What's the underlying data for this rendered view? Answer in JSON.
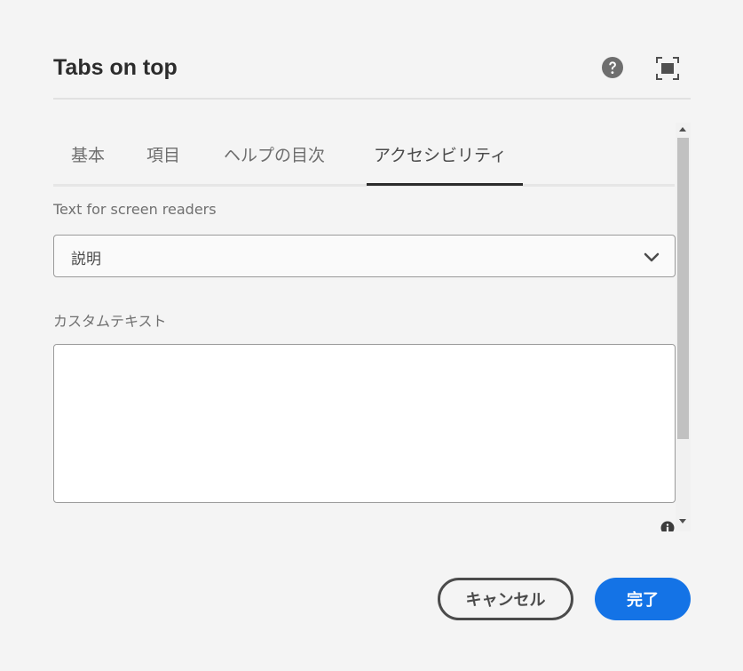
{
  "dialog": {
    "title": "Tabs on top",
    "help_icon": "help-circle-icon",
    "fullscreen_icon": "fullscreen-icon"
  },
  "tabs": [
    {
      "label": "基本",
      "active": false
    },
    {
      "label": "項目",
      "active": false
    },
    {
      "label": "ヘルプの目次",
      "active": false
    },
    {
      "label": "アクセシビリティ",
      "active": true
    }
  ],
  "screen_reader": {
    "label": "Text for screen readers",
    "selected_value": "説明",
    "chevron_icon": "chevron-down-icon"
  },
  "custom_text": {
    "label": "カスタムテキスト",
    "value": "",
    "info_icon": "info-icon"
  },
  "footer": {
    "cancel_label": "キャンセル",
    "done_label": "完了"
  },
  "colors": {
    "accent": "#1473e6",
    "background": "#f4f4f4"
  }
}
